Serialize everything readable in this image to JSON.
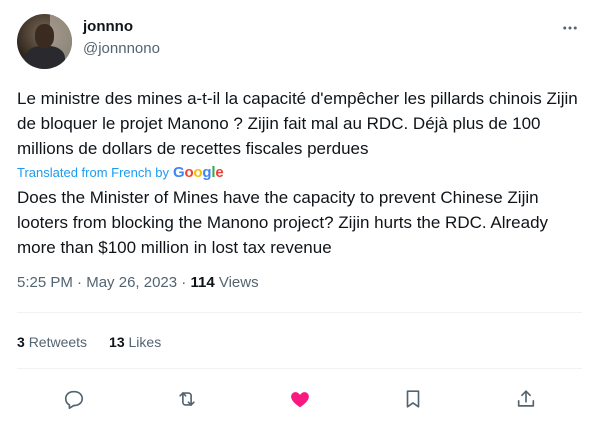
{
  "author": {
    "display_name": "jonnno",
    "handle": "@jonnnono"
  },
  "tweet": {
    "text": "Le ministre des mines a-t-il la capacité d'empêcher les pillards chinois Zijin de bloquer le projet Manono ? Zijin fait mal au RDC. Déjà plus de 100 millions de dollars de recettes fiscales perdues",
    "translated_label": "Translated from French by",
    "translator_brand": [
      "G",
      "o",
      "o",
      "g",
      "l",
      "e"
    ],
    "translation": "Does the Minister of Mines have the capacity to prevent Chinese Zijin looters from blocking the Manono project? Zijin hurts the RDC. Already more than $100 million in lost tax revenue"
  },
  "meta": {
    "time": "5:25 PM",
    "separator": "·",
    "date": "May 26, 2023",
    "views_count": "114",
    "views_label": "Views"
  },
  "stats": {
    "retweets_count": "3",
    "retweets_label": "Retweets",
    "likes_count": "13",
    "likes_label": "Likes"
  },
  "actions": [
    "reply-icon",
    "retweet-icon",
    "like-icon",
    "bookmark-icon",
    "share-icon"
  ],
  "colors": {
    "link_blue": "#1d9bf0",
    "secondary_text": "#536471",
    "like_pink": "#f91880"
  }
}
